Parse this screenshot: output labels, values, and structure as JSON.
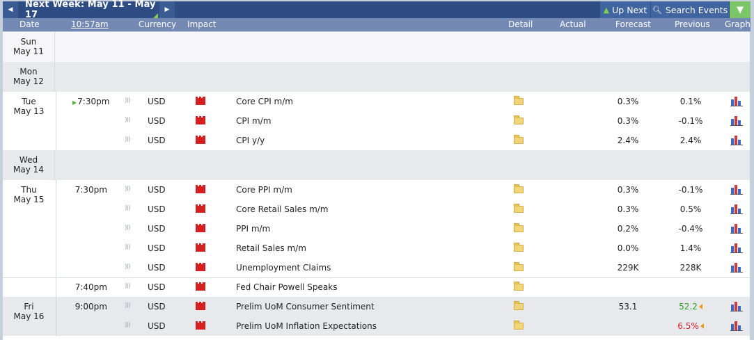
{
  "nav": {
    "prev_icon": "triangle-left",
    "next_icon": "triangle-right",
    "title": "Next Week: May 11 - May 17",
    "up_next_label": "Up Next",
    "up_next_icon": "arrow-up",
    "search_label": "Search Events",
    "search_icon": "magnifier",
    "filter_icon": "funnel"
  },
  "header": {
    "date": "Date",
    "time": "10:57am",
    "currency": "Currency",
    "impact": "Impact",
    "detail": "Detail",
    "actual": "Actual",
    "forecast": "Forecast",
    "previous": "Previous",
    "graph": "Graph"
  },
  "days": [
    {
      "dow": "Sun",
      "date": "May 11"
    },
    {
      "dow": "Mon",
      "date": "May 12"
    },
    {
      "dow": "Tue",
      "date": "May 13"
    },
    {
      "dow": "Wed",
      "date": "May 14"
    },
    {
      "dow": "Thu",
      "date": "May 15"
    },
    {
      "dow": "Fri",
      "date": "May 16"
    }
  ],
  "events": [
    {
      "time": "7:30pm",
      "currency": "USD",
      "impact": "high",
      "title": "Core CPI m/m",
      "actual": "",
      "forecast": "0.3%",
      "previous": "0.1%"
    },
    {
      "time": "",
      "currency": "USD",
      "impact": "high",
      "title": "CPI m/m",
      "actual": "",
      "forecast": "0.3%",
      "previous": "-0.1%"
    },
    {
      "time": "",
      "currency": "USD",
      "impact": "high",
      "title": "CPI y/y",
      "actual": "",
      "forecast": "2.4%",
      "previous": "2.4%"
    },
    {
      "time": "7:30pm",
      "currency": "USD",
      "impact": "high",
      "title": "Core PPI m/m",
      "actual": "",
      "forecast": "0.3%",
      "previous": "-0.1%"
    },
    {
      "time": "",
      "currency": "USD",
      "impact": "high",
      "title": "Core Retail Sales m/m",
      "actual": "",
      "forecast": "0.3%",
      "previous": "0.5%"
    },
    {
      "time": "",
      "currency": "USD",
      "impact": "high",
      "title": "PPI m/m",
      "actual": "",
      "forecast": "0.2%",
      "previous": "-0.4%"
    },
    {
      "time": "",
      "currency": "USD",
      "impact": "high",
      "title": "Retail Sales m/m",
      "actual": "",
      "forecast": "0.0%",
      "previous": "1.4%"
    },
    {
      "time": "",
      "currency": "USD",
      "impact": "high",
      "title": "Unemployment Claims",
      "actual": "",
      "forecast": "229K",
      "previous": "228K"
    },
    {
      "time": "7:40pm",
      "currency": "USD",
      "impact": "high",
      "title": "Fed Chair Powell Speaks",
      "actual": "",
      "forecast": "",
      "previous": ""
    },
    {
      "time": "9:00pm",
      "currency": "USD",
      "impact": "high",
      "title": "Prelim UoM Consumer Sentiment",
      "actual": "",
      "forecast": "53.1",
      "previous": "52.2"
    },
    {
      "time": "",
      "currency": "USD",
      "impact": "high",
      "title": "Prelim UoM Inflation Expectations",
      "actual": "",
      "forecast": "",
      "previous": "6.5%"
    }
  ],
  "colors": {
    "nav_bg": "#2c4c83",
    "header_bg": "#7389b3",
    "impact_high": "#d42020",
    "previous_better": "#2a9d1c",
    "previous_worse": "#d3202b",
    "revision_marker": "#ef9a14"
  }
}
